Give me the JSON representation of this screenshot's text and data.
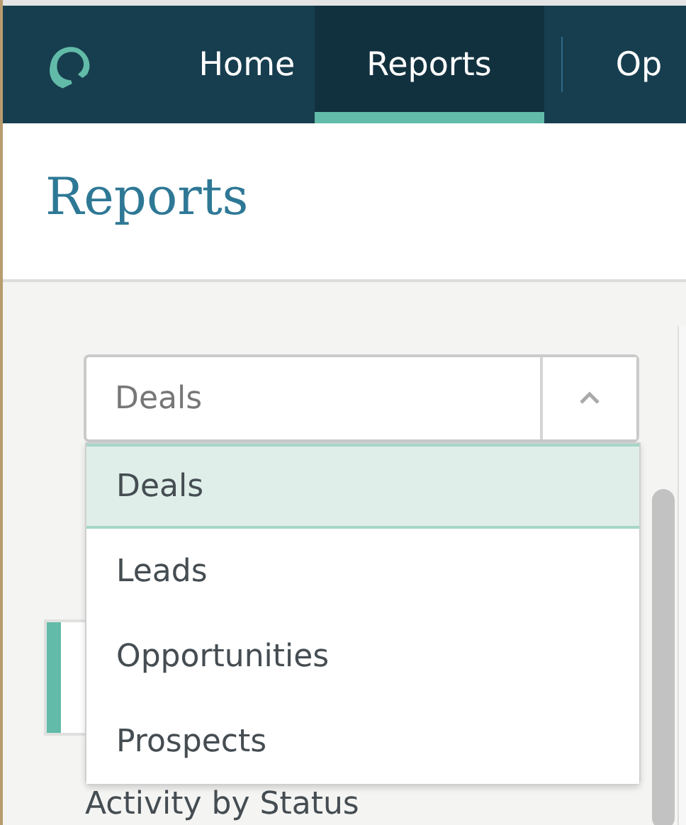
{
  "nav": {
    "tabs": [
      {
        "label": "Home",
        "selected": false
      },
      {
        "label": "Reports",
        "selected": true
      },
      {
        "label": "Op",
        "selected": false
      }
    ]
  },
  "page": {
    "title": "Reports"
  },
  "report_select": {
    "value": "Deals",
    "expanded": true,
    "options": [
      {
        "label": "Deals",
        "selected": true
      },
      {
        "label": "Leads",
        "selected": false
      },
      {
        "label": "Opportunities",
        "selected": false
      },
      {
        "label": "Prospects",
        "selected": false
      }
    ]
  },
  "section": {
    "title": "Activity by Status"
  }
}
